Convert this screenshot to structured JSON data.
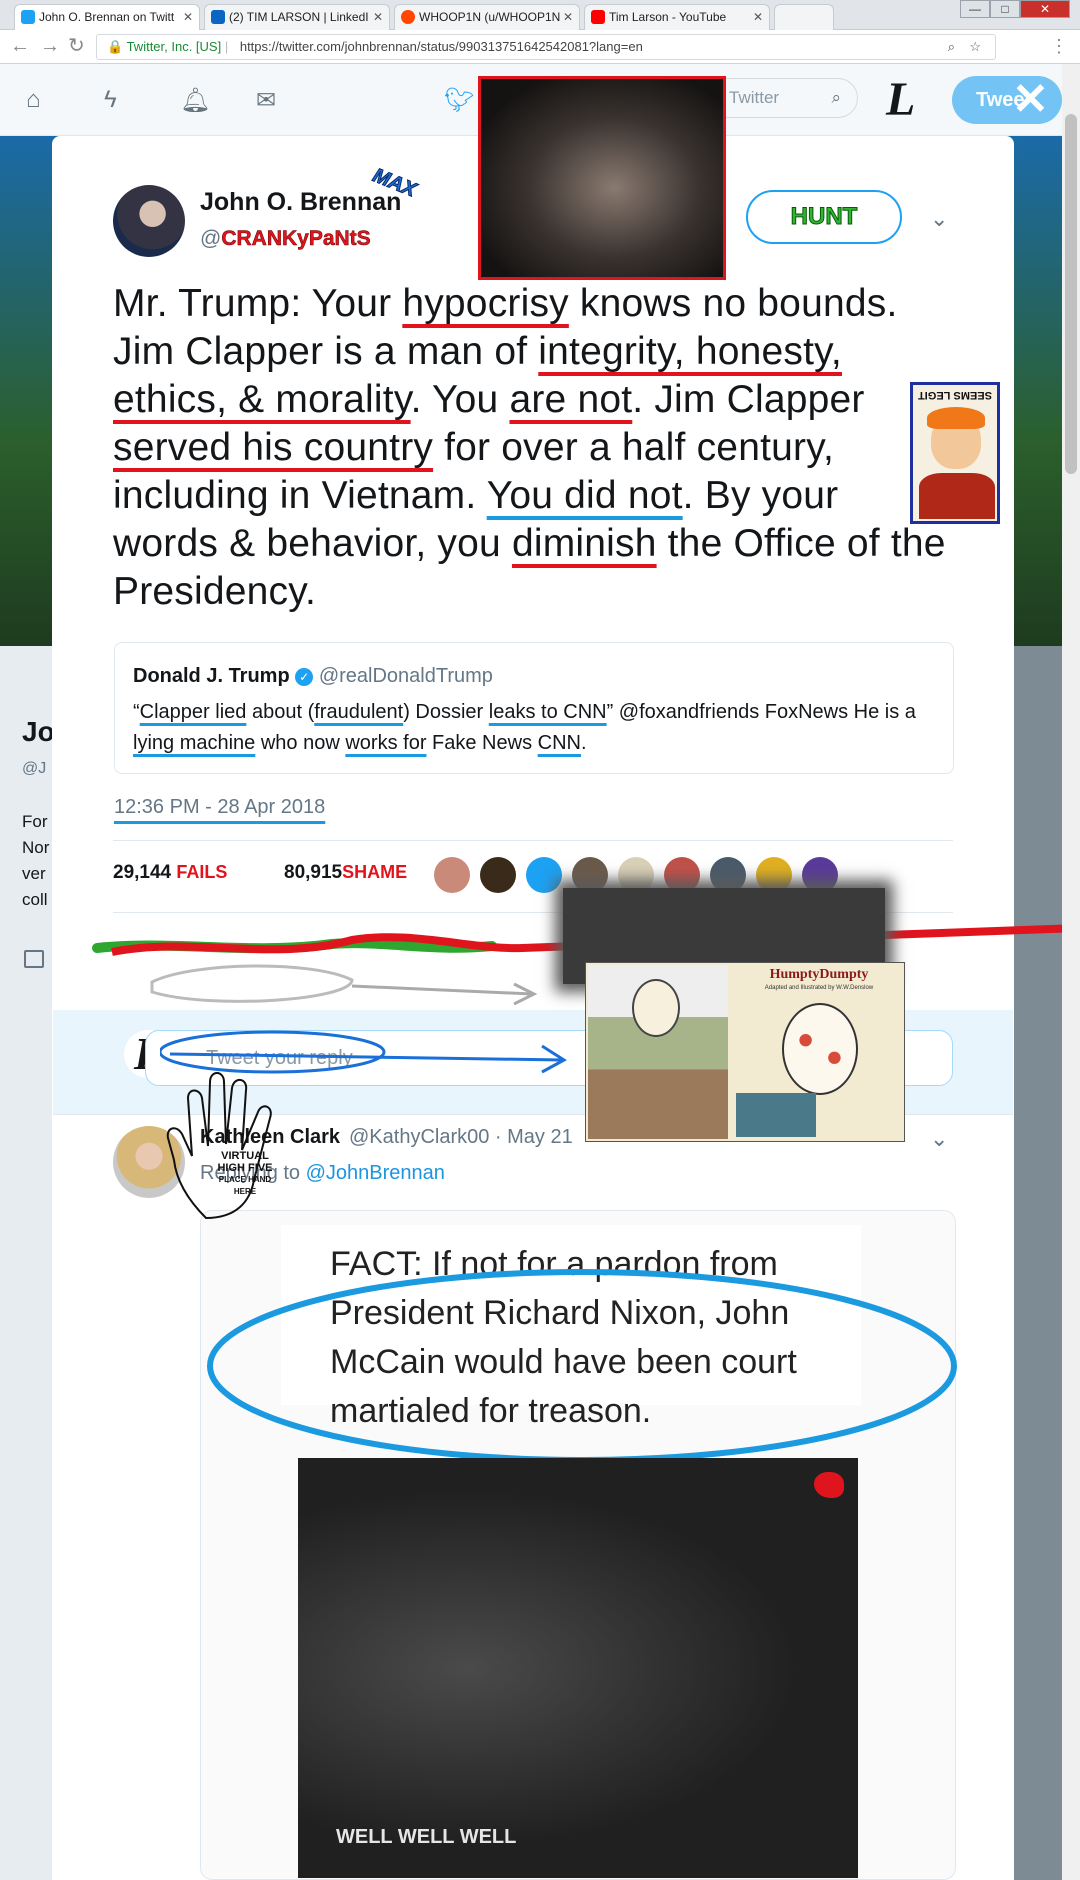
{
  "browser": {
    "tabs": [
      {
        "label": "John O. Brennan on Twitt",
        "icon_color": "#1da1f2",
        "active": true
      },
      {
        "label": "(2) TIM LARSON | LinkedI",
        "icon_color": "#0a66c2",
        "active": false
      },
      {
        "label": "WHOOP1N (u/WHOOP1N",
        "icon_color": "#ff4500",
        "active": false
      },
      {
        "label": "Tim Larson - YouTube",
        "icon_color": "#ff0000",
        "active": false
      }
    ],
    "window_buttons": [
      "—",
      "□",
      "✕"
    ],
    "secure_label": "Twitter, Inc. [US]",
    "url": "https://twitter.com/johnbrennan/status/990313751642542081?lang=en"
  },
  "twitter_nav": {
    "search_placeholder": "Twitter",
    "tweet_button": "Twee",
    "profile_letter": "L",
    "icons": [
      "home-icon",
      "moments-icon",
      "notifications-icon",
      "messages-icon",
      "twitter-bird-icon",
      "search-icon"
    ]
  },
  "backdrop": {
    "profile_name_partial": "Jo",
    "profile_handle_partial": "@J",
    "bio_lines": [
      "For",
      "Nor",
      "ver",
      "coll"
    ]
  },
  "tweet": {
    "display_name": "John O. Brennan",
    "handle_prefix": "@",
    "handle_overlay": "CRANKyPaNtS",
    "name_overlay": "MAX",
    "follow_button": "HUNT",
    "segments": [
      {
        "t": "Mr. Trump: Your ",
        "u": ""
      },
      {
        "t": "hypocrisy",
        "u": "red"
      },
      {
        "t": " knows no bounds. Jim Clapper is a man of ",
        "u": ""
      },
      {
        "t": "integrity, honesty, ethics, & morality",
        "u": "red"
      },
      {
        "t": ". You ",
        "u": ""
      },
      {
        "t": "are not",
        "u": "red"
      },
      {
        "t": ". Jim Clapper ",
        "u": ""
      },
      {
        "t": "served his country",
        "u": "red"
      },
      {
        "t": " for over a half century, including in Vietnam. ",
        "u": ""
      },
      {
        "t": "You did not",
        "u": "blue"
      },
      {
        "t": ". By your words & behavior, you ",
        "u": ""
      },
      {
        "t": "diminish",
        "u": "red"
      },
      {
        "t": " the Office of the Presidency.",
        "u": ""
      }
    ],
    "quote": {
      "name": "Donald J. Trump",
      "handle": "@realDonaldTrump",
      "segments": [
        {
          "t": "“",
          "u": false
        },
        {
          "t": "Clapper lied",
          "u": true
        },
        {
          "t": " about (",
          "u": false
        },
        {
          "t": "fraudulent",
          "u": true
        },
        {
          "t": ") Dossier ",
          "u": false
        },
        {
          "t": "leaks to CNN",
          "u": true
        },
        {
          "t": "” @foxandfriends FoxNews  He is a ",
          "u": false
        },
        {
          "t": "lying machine",
          "u": true
        },
        {
          "t": " who now ",
          "u": false
        },
        {
          "t": "works for",
          "u": true
        },
        {
          "t": " Fake News ",
          "u": false
        },
        {
          "t": "CNN",
          "u": true
        },
        {
          "t": ".",
          "u": false
        }
      ]
    },
    "timestamp": "12:36 PM - 28 Apr 2018",
    "stats": {
      "retweets": "29,144",
      "retweets_label": "FAILS",
      "likes": "80,915",
      "likes_label": "SHAME"
    },
    "liker_colors": [
      "#c98a7a",
      "#3a2a1a",
      "#1da1f2",
      "#6b5a4a",
      "#d9d0b8",
      "#c0504a",
      "#4a5a6a",
      "#e0b020",
      "#5a3a9a"
    ]
  },
  "reply_box": {
    "placeholder": "Tweet your reply",
    "avatar_letter": "L"
  },
  "reply": {
    "name": "Kathleen Clark",
    "handle": "@KathyClark00 · May 21",
    "replying_prefix": "Replying to ",
    "replying_to": "@JohnBrennan",
    "image_text": "FACT: If not for a pardon from President Richard Nixon, John McCain would have been court martialed for treason.",
    "image_caption": "WELL WELL WELL"
  },
  "overlays": {
    "fry_meme_text": "SEEMS LEGIT",
    "hand_text": [
      "VIRTUAL",
      "HIGH FIVE",
      "PLACE HAND",
      "HERE"
    ],
    "humpty_title": "HumptyDumpty",
    "humpty_subtitle": "Adapted and Illustrated by W.W.Denslow"
  }
}
